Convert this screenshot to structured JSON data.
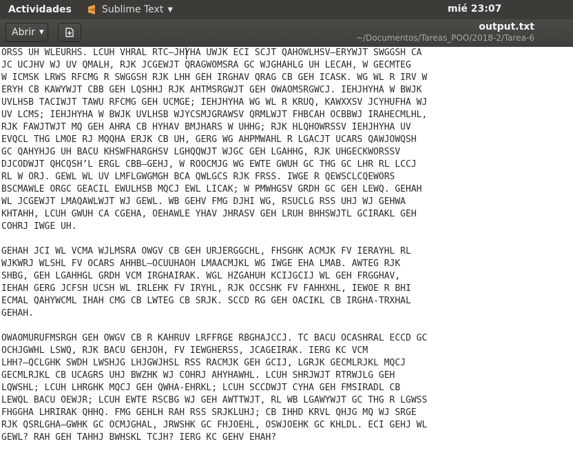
{
  "system": {
    "activities": "Actividades",
    "app_name": "Sublime Text",
    "clock": "mié 23:07"
  },
  "header": {
    "open_label": "Abrir",
    "filename": "output.txt",
    "path": "~/Documentos/Tareas_POO/2018-2/Tarea-6"
  },
  "content": {
    "lines": [
      "ORSS UH WLEURHS. LCUH VHRAL RTC—JHYHA UWJK ECI SCJT QAHOWLHSV—ERYWJT SWGGSH CA",
      "JC UCJHV WJ UV QMALH, RJK JCGEWJT QRAGWOMSRA GC WJGHAHLG UH LECAH, W GECMTEG",
      "W ICMSK LRWS RFCMG R SWGGSH RJK LHH GEH IRGHAV QRAG CB GEH ICASK. WG WL R IRV W",
      "ERYH CB KAWYWJT CBB GEH LQSHHJ RJK AHTMSRGWJT GEH OWAOMSRGWCJ. IEHJHYHA W BWJK",
      "UVLHSB TACIWJT TAWU RFCMG GEH UCMGE; IEHJHYHA WG WL R KRUQ, KAWXXSV JCYHUFHA WJ",
      "UV LCMS; IEHJHYHA W BWJK UVLHSB WJYCSMJGRAWSV QRMLWJT FHBCAH OCBBWJ IRAHECMLHL,",
      "RJK FAWJTWJT MQ GEH AHRA CB HYHAV BMJHARS W UHHG; RJK HLQHOWRSSV IEHJHYHA UV",
      "EVQCL THG LMOE RJ MQQHA ERJK CB UH, GERG WG AHPMWAHL R LGACJT UCARS QAWJOWQSH",
      "GC QAHYHJG UH BACU KHSWFHARGHSV LGHQQWJT WJGC GEH LGAHHG, RJK UHGECKWORSSV",
      "DJCODWJT QHCQSH’L ERGL CBB—GEHJ, W ROOCMJG WG EWTE GWUH GC THG GC LHR RL LCCJ",
      "RL W ORJ. GEWL WL UV LMFLGWGMGH BCA QWLGCS RJK FRSS. IWGE R QEWSCLCQEWORS",
      "BSCMAWLE ORGC GEACIL EWULHSB MQCJ EWL LICAK; W PMWHGSV GRDH GC GEH LEWQ. GEHAH",
      "WL JCGEWJT LMAQAWLWJT WJ GEWL. WB GEHV FMG DJHI WG, RSUCLG RSS UHJ WJ GEHWA",
      "KHTAHH, LCUH GWUH CA CGEHA, OEHAWLE YHAV JHRASV GEH LRUH BHHSWJTL GCIRAKL GEH",
      "COHRJ IWGE UH.",
      "",
      "GEHAH JCI WL VCMA WJLMSRA OWGV CB GEH URJERGGCHL, FHSGHK ACMJK FV IERAYHL RL",
      "WJKWRJ WLSHL FV OCARS AHHBL—OCUUHAOH LMAACMJKL WG IWGE EHA LMAB. AWTEG RJK",
      "SHBG, GEH LGAHHGL GRDH VCM IRGHAIRAK. WGL HZGAHUH KCIJGCIJ WL GEH FRGGHAV,",
      "IEHAH GERG JCFSH UCSH WL IRLEHK FV IRYHL, RJK OCCSHK FV FAHHXHL, IEWOE R BHI",
      "ECMAL QAHYWCML IHAH CMG CB LWTEG CB SRJK. SCCD RG GEH OACIKL CB IRGHA-TRXHAL",
      "GEHAH.",
      "",
      "OWAOMURUFMSRGH GEH OWGV CB R KAHRUV LRFFRGE RBGHAJCCJ. TC BACU OCASHRAL ECCD GC",
      "OCHJGWHL LSWQ, RJK BACU GEHJOH, FV IEWGHERSS, JCAGEIRAK. IERG KC VCM",
      "LHH?—QCLGHK SWDH LWSHJG LHJGWJHSL RSS RACMJK GEH GCIJ, LGRJK GECMLRJKL MQCJ",
      "GECMLRJKL CB UCAGRS UHJ BWZHK WJ COHRJ AHYHAWHL. LCUH SHRJWJT RTRWJLG GEH",
      "LQWSHL; LCUH LHRGHK MQCJ GEH QWHA-EHRKL; LCUH SCCDWJT CYHA GEH FMSIRADL CB",
      "LEWQL BACU OEWJR; LCUH EWTE RSCBG WJ GEH AWTTWJT, RL WB LGAWYWJT GC THG R LGWSS",
      "FHGGHA LHRIRAK QHHQ. FMG GEHLH RAH RSS SRJKLUHJ; CB IHHD KRVL QHJG MQ WJ SRGE",
      "RJK QSRLGHA—GWHK GC OCMJGHAL, JRWSHK GC FHJOEHL, OSWJOEHK GC KHLDL. ECI GEHJ WL",
      "GEWL? RAH GEH TAHHJ BWHSKL TCJH? IERG KC GEHV EHAH?"
    ]
  },
  "colors": {
    "topbar": "#3c3b37",
    "headerbar": "#45443f",
    "text": "#2a2a2a",
    "sublime_accent": "#f0a14b"
  },
  "icons": [
    "sublime-logo-icon",
    "chevron-down-icon",
    "new-document-icon"
  ]
}
